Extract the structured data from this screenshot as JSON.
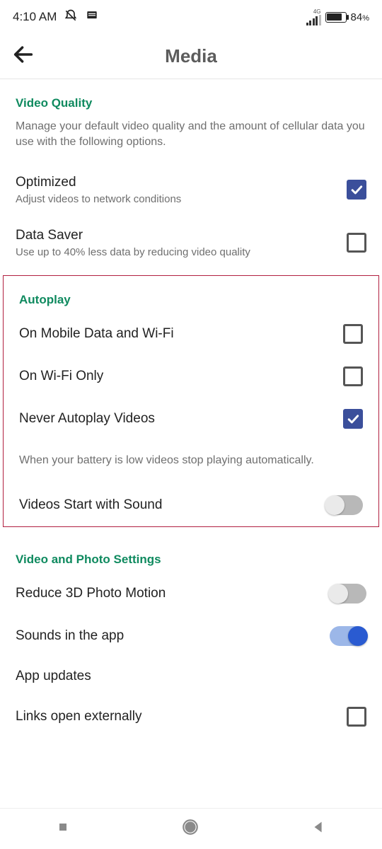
{
  "status": {
    "time": "4:10 AM",
    "network": "4G",
    "battery": "84"
  },
  "header": {
    "title": "Media"
  },
  "sections": {
    "videoQuality": {
      "title": "Video Quality",
      "desc": "Manage your default video quality and the amount of cellular data you use with the following options.",
      "optimized": {
        "label": "Optimized",
        "sub": "Adjust videos to network conditions"
      },
      "dataSaver": {
        "label": "Data Saver",
        "sub": "Use up to 40% less data by reducing video quality"
      }
    },
    "autoplay": {
      "title": "Autoplay",
      "mobileWifi": "On Mobile Data and Wi-Fi",
      "wifiOnly": "On Wi-Fi Only",
      "never": "Never Autoplay Videos",
      "batteryNote": "When your battery is low videos stop playing automatically.",
      "sound": "Videos Start with Sound"
    },
    "vps": {
      "title": "Video and Photo Settings",
      "reduce3d": "Reduce 3D Photo Motion",
      "sounds": "Sounds in the app",
      "updates": "App updates",
      "links": "Links open externally"
    }
  }
}
